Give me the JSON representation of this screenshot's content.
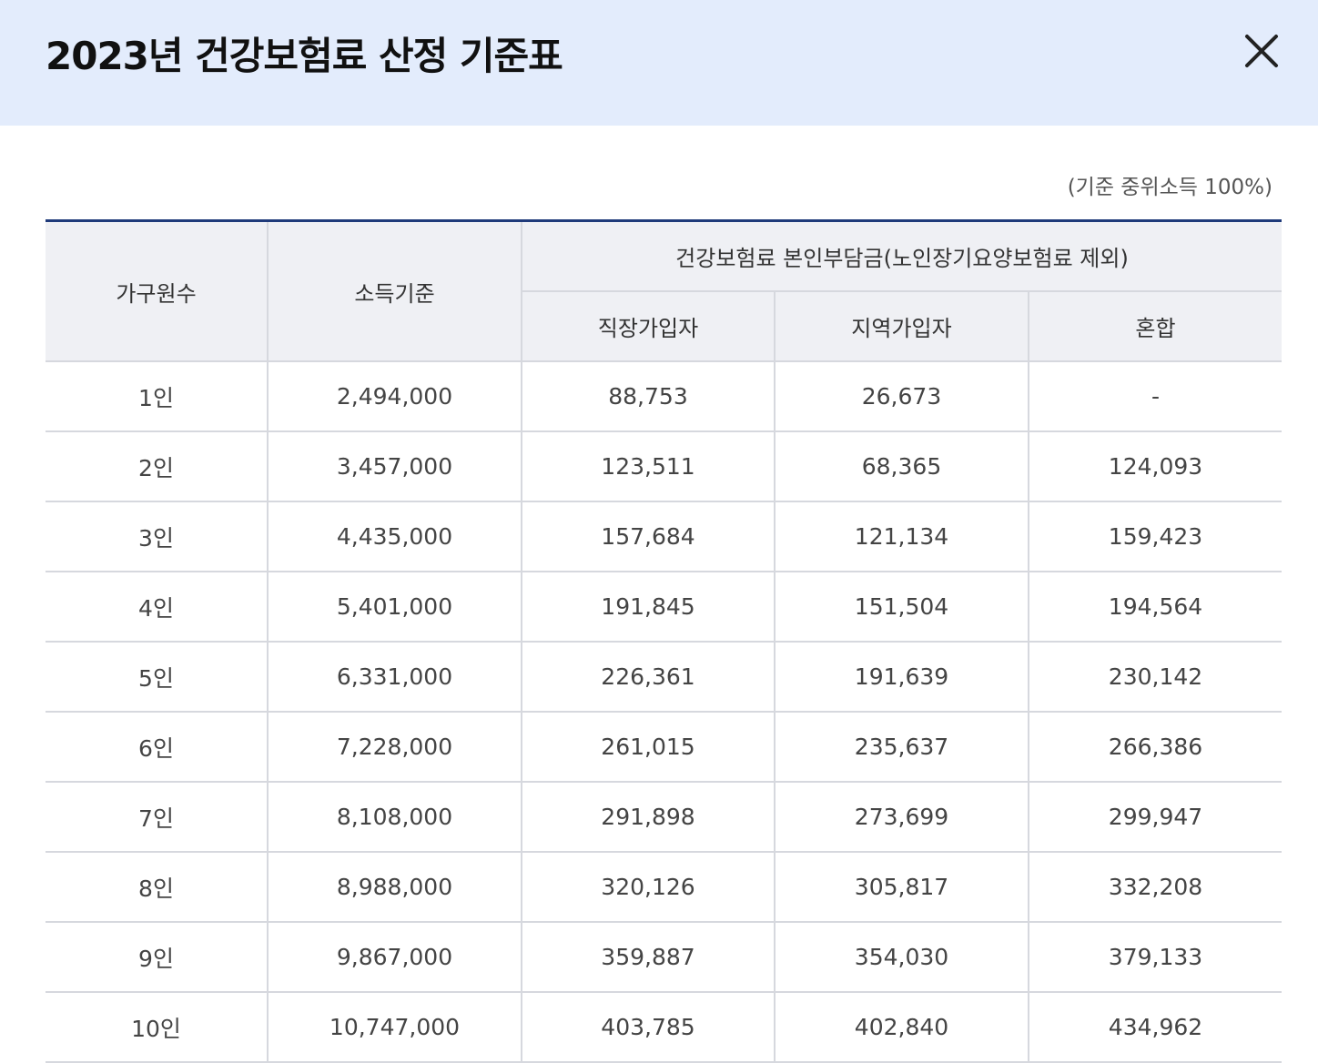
{
  "header": {
    "title": "2023년 건강보험료 산정 기준표",
    "close_icon": "close-icon"
  },
  "note": "(기준 중위소득 100%)",
  "table": {
    "headers": {
      "household": "가구원수",
      "income": "소득기준",
      "group": "건강보험료 본인부담금(노인장기요양보험료 제외)",
      "employee": "직장가입자",
      "regional": "지역가입자",
      "mixed": "혼합"
    },
    "rows": [
      [
        "1인",
        "2,494,000",
        "88,753",
        "26,673",
        "-"
      ],
      [
        "2인",
        "3,457,000",
        "123,511",
        "68,365",
        "124,093"
      ],
      [
        "3인",
        "4,435,000",
        "157,684",
        "121,134",
        "159,423"
      ],
      [
        "4인",
        "5,401,000",
        "191,845",
        "151,504",
        "194,564"
      ],
      [
        "5인",
        "6,331,000",
        "226,361",
        "191,639",
        "230,142"
      ],
      [
        "6인",
        "7,228,000",
        "261,015",
        "235,637",
        "266,386"
      ],
      [
        "7인",
        "8,108,000",
        "291,898",
        "273,699",
        "299,947"
      ],
      [
        "8인",
        "8,988,000",
        "320,126",
        "305,817",
        "332,208"
      ],
      [
        "9인",
        "9,867,000",
        "359,887",
        "354,030",
        "379,133"
      ],
      [
        "10인",
        "10,747,000",
        "403,785",
        "402,840",
        "434,962"
      ]
    ]
  },
  "colors": {
    "header_bg": "#e3ecfc",
    "table_top_border": "#1f3a7a",
    "th_bg": "#eff0f4"
  }
}
